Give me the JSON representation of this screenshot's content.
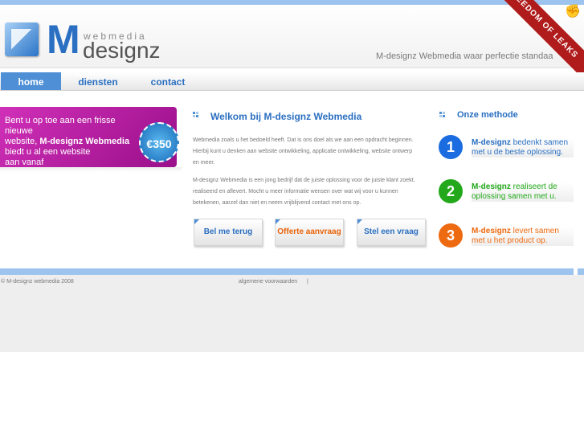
{
  "header": {
    "logo": {
      "webmedia": "webmedia",
      "m": "M",
      "designz": "designz"
    },
    "tagline": "M-designz Webmedia waar perfectie standaa",
    "ribbon_text": "FREEDOM OF LEAKS"
  },
  "nav": {
    "items": [
      {
        "label": "home"
      },
      {
        "label": "diensten"
      },
      {
        "label": "contact"
      }
    ]
  },
  "promo": {
    "line1": "Bent u op toe aan een frisse nieuwe",
    "line2": "website,",
    "brand": "M-designz Webmedia",
    "line3": "biedt u al een website",
    "line4": "aan vanaf",
    "price": "€350"
  },
  "main": {
    "title": "Welkom bij M-designz Webmedia",
    "para1": "Webmedia zoals u het bedoeld heeft. Dat is ons doel als we aan een opdracht beginnen. Hierbij kunt u denken aan website ontwikkeling, applicatie ontwikkeling, website ontwerp en meer.",
    "para2": "M-designz Webmedia is een jong bedrijf dat de juiste oplossing voor de juiste klant zoekt, realiseerd en aflevert. Mocht u meer informatie wensen over wat wij voor u kunnen betekenen, aarzel dan niet en neem vrijblijvend contact met ons op.",
    "buttons": [
      {
        "label": "Bel me terug"
      },
      {
        "label": "Offerte aanvraag"
      },
      {
        "label": "Stel een vraag"
      }
    ]
  },
  "method": {
    "title": "Onze methode",
    "steps": [
      {
        "num": "1",
        "brand": "M-designz",
        "text": "bedenkt samen met u de beste oplossing.",
        "color": "#1a6ce0"
      },
      {
        "num": "2",
        "brand": "M-designz",
        "text": "realiseert de oplossing samen met u.",
        "color": "#22a81a"
      },
      {
        "num": "3",
        "brand": "M-designz",
        "text": "levert samen met u het product op.",
        "color": "#ee6a10"
      }
    ]
  },
  "footer": {
    "copyright": "© M-designz webmedia 2008",
    "link": "algemene voorwaarden",
    "separator": "|"
  },
  "colors": {
    "accent": "#2a6fc1",
    "promo": "#c024ad",
    "orange_text": "#e8630a"
  }
}
